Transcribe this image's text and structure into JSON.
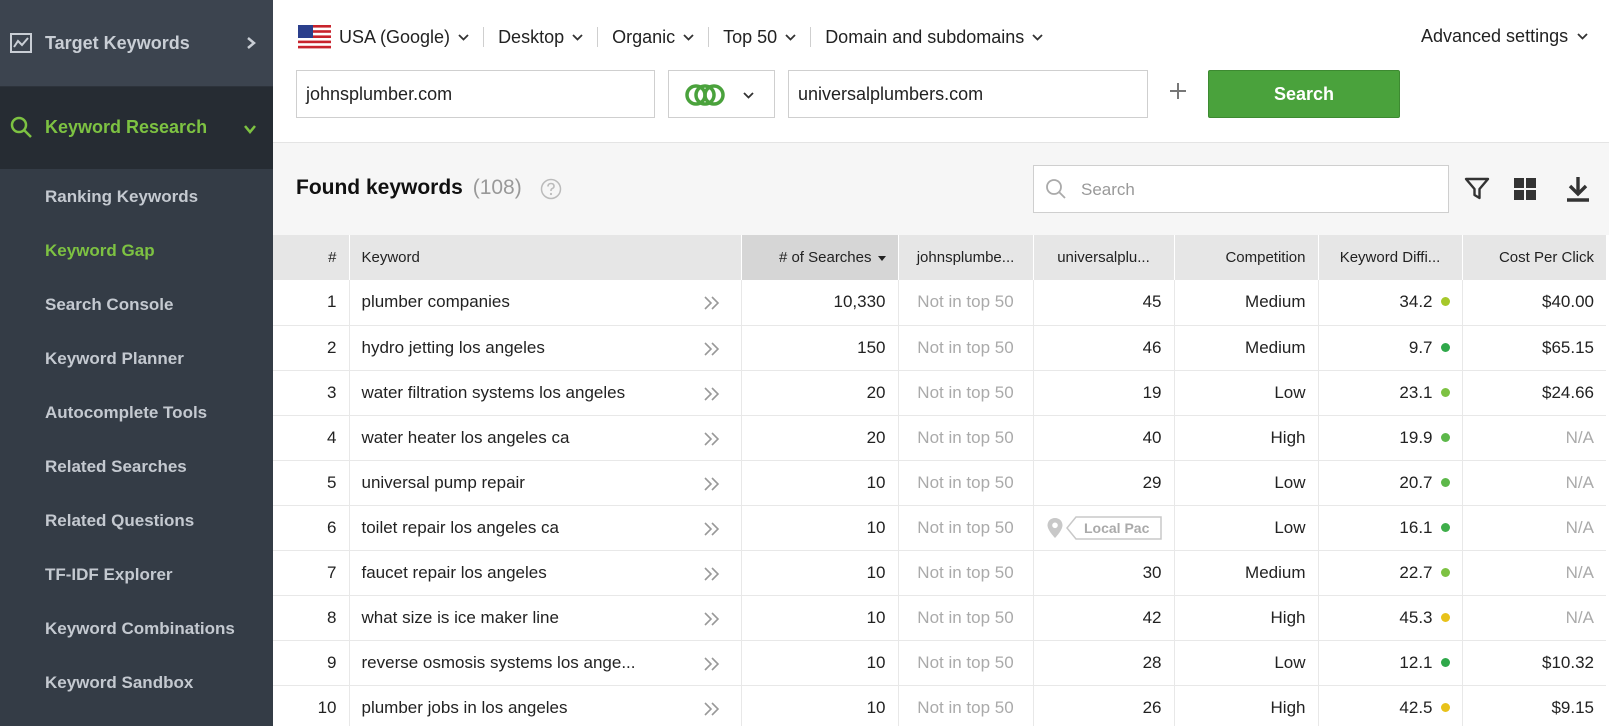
{
  "sidebar": {
    "top_item": {
      "label": "Target Keywords",
      "icon": "chart-line-icon"
    },
    "active_section": {
      "label": "Keyword Research",
      "icon": "search-icon"
    },
    "items": [
      {
        "label": "Ranking Keywords",
        "active": false
      },
      {
        "label": "Keyword Gap",
        "active": true
      },
      {
        "label": "Search Console",
        "active": false
      },
      {
        "label": "Keyword Planner",
        "active": false
      },
      {
        "label": "Autocomplete Tools",
        "active": false
      },
      {
        "label": "Related Searches",
        "active": false
      },
      {
        "label": "Related Questions",
        "active": false
      },
      {
        "label": "TF-IDF Explorer",
        "active": false
      },
      {
        "label": "Keyword Combinations",
        "active": false
      },
      {
        "label": "Keyword Sandbox",
        "active": false
      }
    ]
  },
  "filters": {
    "location": "USA (Google)",
    "device": "Desktop",
    "type": "Organic",
    "top": "Top 50",
    "scope": "Domain and subdomains",
    "advanced": "Advanced settings"
  },
  "search_row": {
    "domain1": "johnsplumber.com",
    "domain2": "universalplumbers.com",
    "search_button": "Search"
  },
  "results": {
    "title": "Found keywords",
    "count": "(108)",
    "search_placeholder": "Search"
  },
  "table": {
    "headers": {
      "num": "#",
      "keyword": "Keyword",
      "searches": "# of Searches",
      "domain1": "johnsplumbe...",
      "domain2": "universalplu...",
      "competition": "Competition",
      "difficulty": "Keyword Diffi...",
      "cpc": "Cost Per Click"
    },
    "local_pack_label": "Local Pac",
    "rows": [
      {
        "num": "1",
        "keyword": "plumber companies",
        "searches": "10,330",
        "d1": "Not in top 50",
        "d2": "45",
        "competition": "Medium",
        "difficulty": "34.2",
        "dot": "#a6c82a",
        "cpc": "$40.00"
      },
      {
        "num": "2",
        "keyword": "hydro jetting los angeles",
        "searches": "150",
        "d1": "Not in top 50",
        "d2": "46",
        "competition": "Medium",
        "difficulty": "9.7",
        "dot": "#2fa84a",
        "cpc": "$65.15"
      },
      {
        "num": "3",
        "keyword": "water filtration systems los angeles",
        "searches": "20",
        "d1": "Not in top 50",
        "d2": "19",
        "competition": "Low",
        "difficulty": "23.1",
        "dot": "#7dc242",
        "cpc": "$24.66"
      },
      {
        "num": "4",
        "keyword": "water heater los angeles ca",
        "searches": "20",
        "d1": "Not in top 50",
        "d2": "40",
        "competition": "High",
        "difficulty": "19.9",
        "dot": "#5db84a",
        "cpc": "N/A"
      },
      {
        "num": "5",
        "keyword": "universal pump repair",
        "searches": "10",
        "d1": "Not in top 50",
        "d2": "29",
        "competition": "Low",
        "difficulty": "20.7",
        "dot": "#5db84a",
        "cpc": "N/A"
      },
      {
        "num": "6",
        "keyword": "toilet repair los angeles ca",
        "searches": "10",
        "d1": "Not in top 50",
        "d2": "",
        "competition": "Low",
        "difficulty": "16.1",
        "dot": "#3fae4a",
        "cpc": "N/A"
      },
      {
        "num": "7",
        "keyword": "faucet repair los angeles",
        "searches": "10",
        "d1": "Not in top 50",
        "d2": "30",
        "competition": "Medium",
        "difficulty": "22.7",
        "dot": "#7dc242",
        "cpc": "N/A"
      },
      {
        "num": "8",
        "keyword": "what size is ice maker line",
        "searches": "10",
        "d1": "Not in top 50",
        "d2": "42",
        "competition": "High",
        "difficulty": "45.3",
        "dot": "#e8c21a",
        "cpc": "N/A"
      },
      {
        "num": "9",
        "keyword": "reverse osmosis systems los ange...",
        "searches": "10",
        "d1": "Not in top 50",
        "d2": "28",
        "competition": "Low",
        "difficulty": "12.1",
        "dot": "#2fa84a",
        "cpc": "$10.32"
      },
      {
        "num": "10",
        "keyword": "plumber jobs in los angeles",
        "searches": "10",
        "d1": "Not in top 50",
        "d2": "26",
        "competition": "High",
        "difficulty": "42.5",
        "dot": "#e8c21a",
        "cpc": "$9.15"
      }
    ]
  }
}
